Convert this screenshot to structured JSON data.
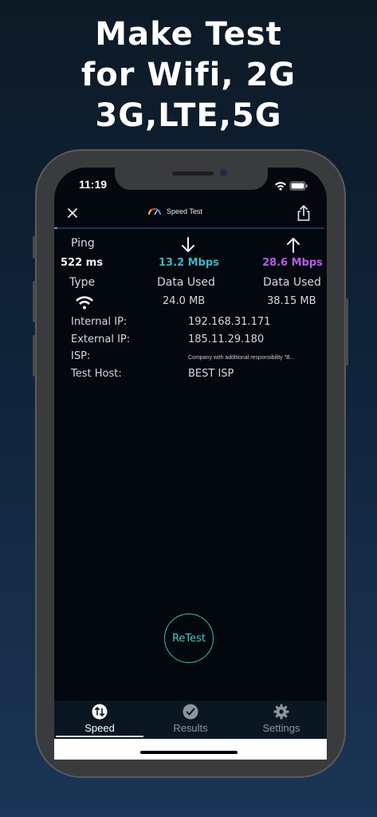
{
  "headline": {
    "line1": "Make Test",
    "line2": "for Wifi, 2G",
    "line3": "3G,LTE,5G"
  },
  "status_bar": {
    "time": "11:19"
  },
  "nav": {
    "title": "Speed Test"
  },
  "stats": {
    "ping_label": "Ping",
    "ping_value": "522 ms",
    "download_value": "13.2 Mbps",
    "upload_value": "28.6 Mbps",
    "type_label": "Type",
    "download_data_label": "Data Used",
    "upload_data_label": "Data Used",
    "download_data_value": "24.0 MB",
    "upload_data_value": "38.15 MB"
  },
  "info": {
    "internal_ip_label": "Internal IP:",
    "internal_ip_value": "192.168.31.171",
    "external_ip_label": "External IP:",
    "external_ip_value": "185.11.29.180",
    "isp_label": "ISP:",
    "isp_value": "Company with additional responsibility \"B...",
    "test_host_label": "Test Host:",
    "test_host_value": "BEST ISP"
  },
  "retest_label": "ReTest",
  "tabs": [
    {
      "label": "Speed",
      "icon": "speed-arrows-icon",
      "active": true
    },
    {
      "label": "Results",
      "icon": "checkmark-circle-icon",
      "active": false
    },
    {
      "label": "Settings",
      "icon": "gear-icon",
      "active": false
    }
  ],
  "colors": {
    "download": "#3fb4c6",
    "upload": "#b35ce6",
    "accent": "#45c8cc",
    "screen_bg": "#02080d"
  }
}
